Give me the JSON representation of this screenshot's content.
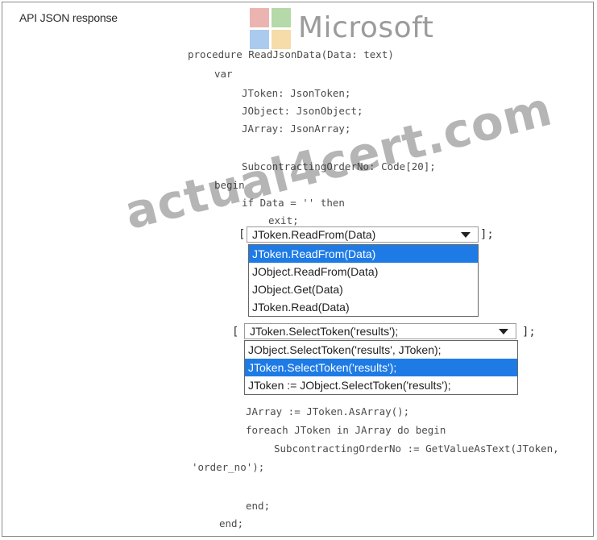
{
  "title": "API JSON response",
  "logo": {
    "text": "Microsoft",
    "colors": [
      "#f25022",
      "#7fba00",
      "#00a4ef",
      "#ffb900"
    ]
  },
  "code": {
    "procedure": "procedure ReadJsonData(Data: text)",
    "var": "var",
    "jtoken": "JToken: JsonToken;",
    "jobject": "JObject: JsonObject;",
    "jarray": "JArray: JsonArray;",
    "orderno": "SubcontractingOrderNo: Code[20];",
    "begin": "begin",
    "if": "if Data = '' then",
    "exit": "exit;",
    "asarray": "JArray := JToken.AsArray();",
    "foreach": "foreach JToken in JArray do begin",
    "getvalue": "SubcontractingOrderNo := GetValueAsText(JToken,",
    "getvalue_cont": "'order_no');",
    "end1": "end;",
    "end2": "end;"
  },
  "dropdown1": {
    "open_bracket": "[",
    "close_bracket": "];",
    "selected": "JToken.ReadFrom(Data)",
    "options": [
      "JToken.ReadFrom(Data)",
      "JObject.ReadFrom(Data)",
      "JObject.Get(Data)",
      "JToken.Read(Data)"
    ]
  },
  "dropdown2": {
    "open_bracket": "[",
    "close_bracket": "];",
    "selected": "JToken.SelectToken('results');",
    "options": [
      "JObject.SelectToken('results', JToken);",
      "JToken.SelectToken('results');",
      "JToken := JObject.SelectToken('results');"
    ]
  },
  "watermark": "actual4cert.com"
}
